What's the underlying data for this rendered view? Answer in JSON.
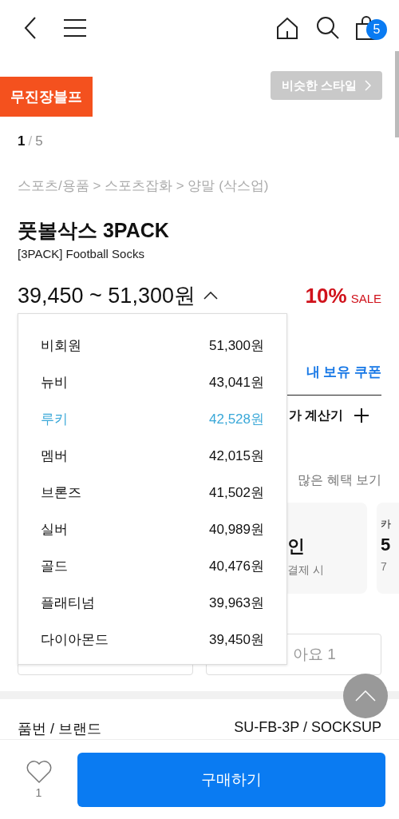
{
  "header": {
    "cart_count": "5"
  },
  "promo_badge": "무진장블프",
  "similar_button": "비슷한 스타일",
  "image_counter": {
    "current": "1",
    "separator": "/",
    "total": "5"
  },
  "breadcrumb": "스포츠/용품 > 스포츠잡화 > 양말 (삭스업)",
  "title": "풋볼삭스 3PACK",
  "subtitle": "[3PACK] Football Socks",
  "price": {
    "range": "39,450 ~ 51,300원",
    "expanded": true,
    "discount": "10%",
    "sale_label": "SALE"
  },
  "member_prices": [
    {
      "grade": "비회원",
      "price": "51,300원",
      "selected": false
    },
    {
      "grade": "뉴비",
      "price": "43,041원",
      "selected": false
    },
    {
      "grade": "루키",
      "price": "42,528원",
      "selected": true
    },
    {
      "grade": "멤버",
      "price": "42,015원",
      "selected": false
    },
    {
      "grade": "브론즈",
      "price": "41,502원",
      "selected": false
    },
    {
      "grade": "실버",
      "price": "40,989원",
      "selected": false
    },
    {
      "grade": "골드",
      "price": "40,476원",
      "selected": false
    },
    {
      "grade": "플래티넘",
      "price": "39,963원",
      "selected": false
    },
    {
      "grade": "다이아몬드",
      "price": "39,450원",
      "selected": false
    }
  ],
  "coupon_link": "내 보유 쿠폰",
  "calculator": {
    "label": "가 계산기"
  },
  "benefits_link": "많은 혜택 보기",
  "benefit_cards": [
    {
      "title": "인",
      "note": "결제 시"
    },
    {
      "label": "카",
      "title": "5",
      "note": "7"
    }
  ],
  "like_button": "아요 1",
  "info_rows": [
    {
      "label": "품번 / 브랜드",
      "value": "SU-FB-3P / SOCKSUP"
    }
  ],
  "bottom_bar": {
    "like_count": "1",
    "buy_button": "구매하기"
  }
}
